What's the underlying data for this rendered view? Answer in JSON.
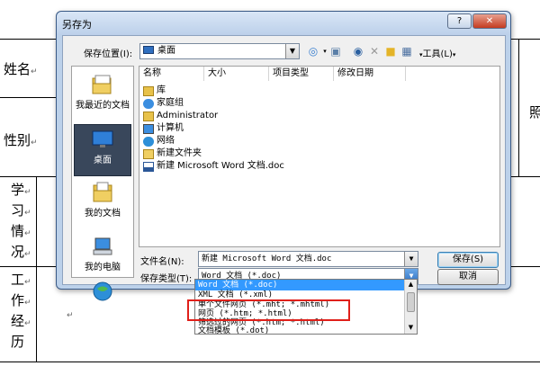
{
  "document": {
    "name_label": "姓名",
    "gender_label": "性别",
    "photo_label": "照",
    "study_chars": [
      "学",
      "习",
      "情",
      "况"
    ],
    "work_chars": [
      "工",
      "作",
      "经",
      "历"
    ],
    "paragraph_mark": "↵"
  },
  "dialog": {
    "title": "另存为",
    "help_button": "?",
    "close_button": "✕",
    "location_label": "保存位置(I):",
    "location_value": "桌面",
    "tools_label": "工具(L)",
    "places": [
      {
        "label": "我最近的文档",
        "icon": "recent-documents-icon"
      },
      {
        "label": "桌面",
        "icon": "desktop-icon"
      },
      {
        "label": "我的文档",
        "icon": "my-documents-icon"
      },
      {
        "label": "我的电脑",
        "icon": "my-computer-icon"
      },
      {
        "label": "",
        "icon": "network-places-icon"
      }
    ],
    "columns": [
      "名称",
      "大小",
      "项目类型",
      "修改日期"
    ],
    "files": [
      {
        "name": "库",
        "icon": "library-icon"
      },
      {
        "name": "家庭组",
        "icon": "homegroup-icon"
      },
      {
        "name": "Administrator",
        "icon": "user-folder-icon"
      },
      {
        "name": "计算机",
        "icon": "computer-icon"
      },
      {
        "name": "网络",
        "icon": "network-icon"
      },
      {
        "name": "新建文件夹",
        "icon": "folder-icon"
      },
      {
        "name": "新建 Microsoft Word 文档.doc",
        "icon": "word-document-icon"
      }
    ],
    "filename_label": "文件名(N):",
    "filename_value": "新建 Microsoft Word 文档.doc",
    "filetype_label": "保存类型(T):",
    "filetype_value": "Word 文档 (*.doc)",
    "save_button": "保存(S)",
    "cancel_button": "取消",
    "filetype_options": [
      "Word 文档 (*.doc)",
      "XML 文档 (*.xml)",
      "单个文件网页 (*.mht; *.mhtml)",
      "网页 (*.htm; *.html)",
      "筛选过的网页 (*.htm; *.html)",
      "文档模板 (*.dot)"
    ]
  },
  "colors": {
    "highlight": "#3399ff",
    "annotation_box": "#e0201a"
  }
}
